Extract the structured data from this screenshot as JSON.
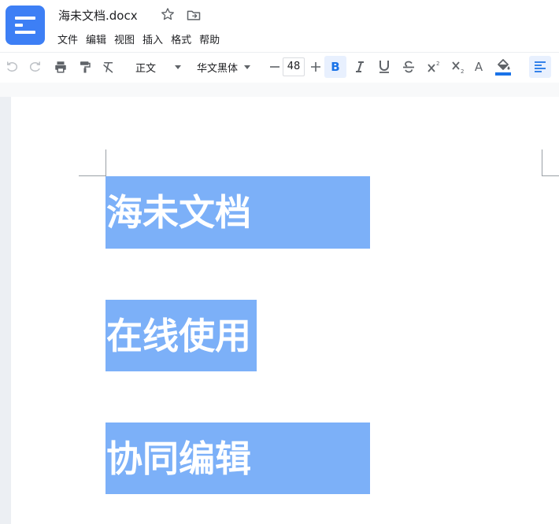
{
  "header": {
    "doc_title": "海未文档.docx",
    "menu": [
      "文件",
      "编辑",
      "视图",
      "插入",
      "格式",
      "帮助"
    ]
  },
  "toolbar": {
    "style_label": "正文",
    "font_label": "华文黑体",
    "font_size": "48",
    "bold_label": "B",
    "text_color_label": "A",
    "accent_color": "#3d7ff5",
    "fill_color": "#1a73e8"
  },
  "document": {
    "paragraphs": [
      "海未文档",
      "在线使用",
      "协同编辑"
    ],
    "highlight_color": "#7cb0f8"
  }
}
